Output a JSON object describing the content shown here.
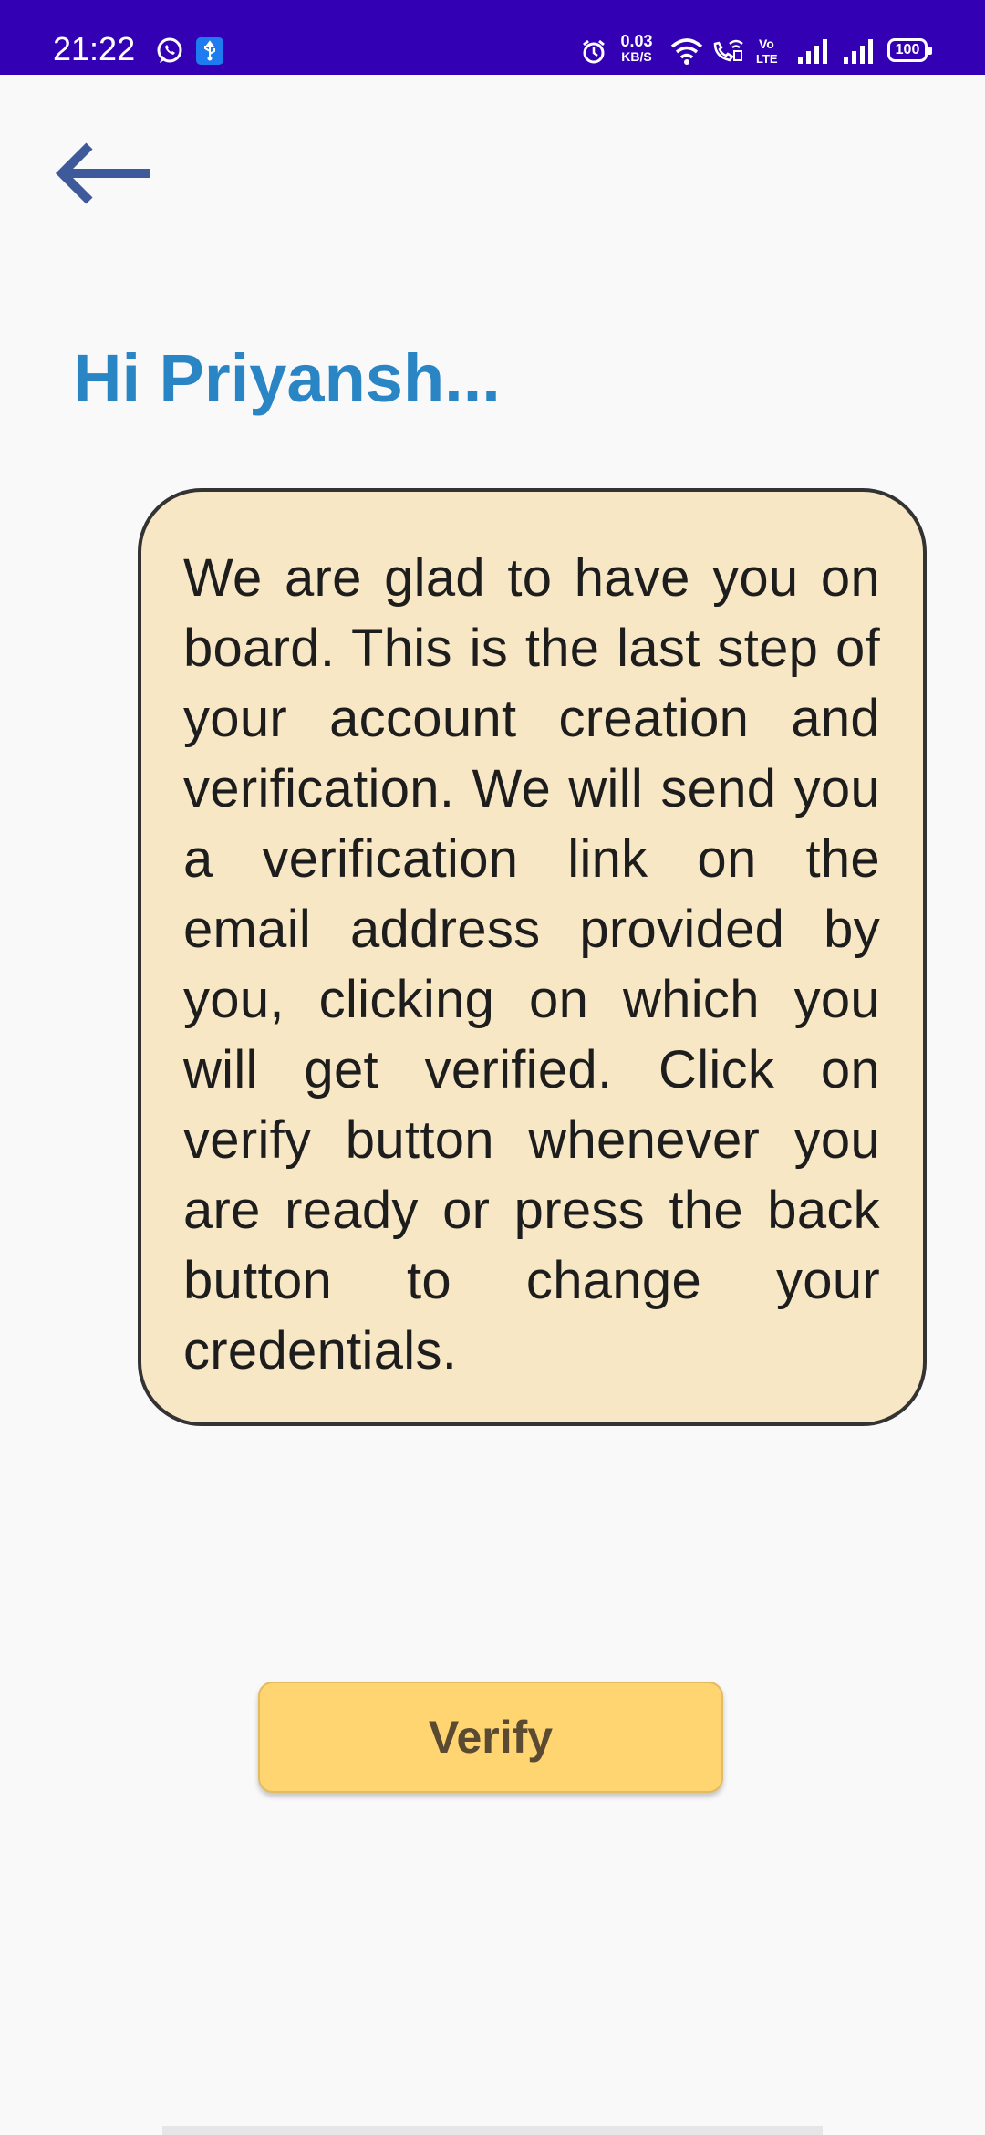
{
  "status_bar": {
    "time": "21:22",
    "net_speed_value": "0.03",
    "net_speed_unit": "KB/S",
    "battery": "100",
    "background_color": "#3300b3",
    "icons": [
      "whatsapp-icon",
      "usb-icon",
      "alarm-icon",
      "wifi-icon",
      "wifi-calling-icon",
      "volte-icon",
      "signal-icon",
      "signal-icon",
      "battery-icon"
    ]
  },
  "header": {
    "back_icon": "arrow-left-icon"
  },
  "greeting": "Hi Priyansh...",
  "message": "We are glad to have you on board. This is the last step of your account creation and verification. We will send you a verification link on the email address provided by you, clicking on which you will get verified. Click on verify button whenever you are ready or press the back button to change your credentials.",
  "actions": {
    "verify_label": "Verify"
  },
  "colors": {
    "accent": "#2a85c4",
    "card": "#f8e7c4",
    "button": "#ffd571",
    "back_arrow": "#3e5a9a"
  }
}
